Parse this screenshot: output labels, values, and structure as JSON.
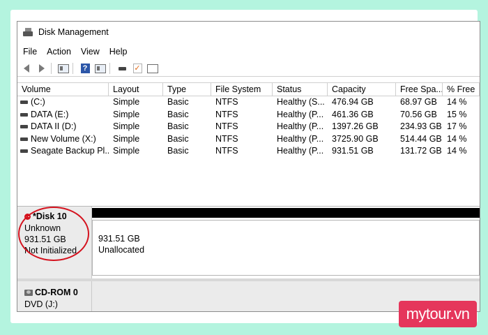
{
  "window": {
    "title": "Disk Management"
  },
  "menu": [
    "File",
    "Action",
    "View",
    "Help"
  ],
  "toolbar": {
    "icons": [
      "back-icon",
      "forward-icon",
      "console-tree-icon",
      "help-icon",
      "properties-icon",
      "connect-icon",
      "check-icon",
      "list-icon"
    ]
  },
  "volumes": {
    "columns": [
      "Volume",
      "Layout",
      "Type",
      "File System",
      "Status",
      "Capacity",
      "Free Spa...",
      "% Free"
    ],
    "rows": [
      {
        "volume": "(C:)",
        "layout": "Simple",
        "type": "Basic",
        "fs": "NTFS",
        "status": "Healthy (S...",
        "capacity": "476.94 GB",
        "free": "68.97 GB",
        "pct": "14 %"
      },
      {
        "volume": "DATA (E:)",
        "layout": "Simple",
        "type": "Basic",
        "fs": "NTFS",
        "status": "Healthy (P...",
        "capacity": "461.36 GB",
        "free": "70.56 GB",
        "pct": "15 %"
      },
      {
        "volume": "DATA II (D:)",
        "layout": "Simple",
        "type": "Basic",
        "fs": "NTFS",
        "status": "Healthy (P...",
        "capacity": "1397.26 GB",
        "free": "234.93 GB",
        "pct": "17 %"
      },
      {
        "volume": "New Volume (X:)",
        "layout": "Simple",
        "type": "Basic",
        "fs": "NTFS",
        "status": "Healthy (P...",
        "capacity": "3725.90 GB",
        "free": "514.44 GB",
        "pct": "14 %"
      },
      {
        "volume": "Seagate Backup Pl...",
        "layout": "Simple",
        "type": "Basic",
        "fs": "NTFS",
        "status": "Healthy (P...",
        "capacity": "931.51 GB",
        "free": "131.72 GB",
        "pct": "14 %"
      }
    ]
  },
  "disk10": {
    "name": "*Disk 10",
    "kind": "Unknown",
    "size": "931.51 GB",
    "state": "Not Initialized",
    "partition_size": "931.51 GB",
    "partition_state": "Unallocated",
    "highlight_color": "#d4121e"
  },
  "cdrom": {
    "name": "CD-ROM 0",
    "drive": "DVD (J:)"
  },
  "watermark": {
    "text": "mytour.vn",
    "color": "#e5365b"
  }
}
